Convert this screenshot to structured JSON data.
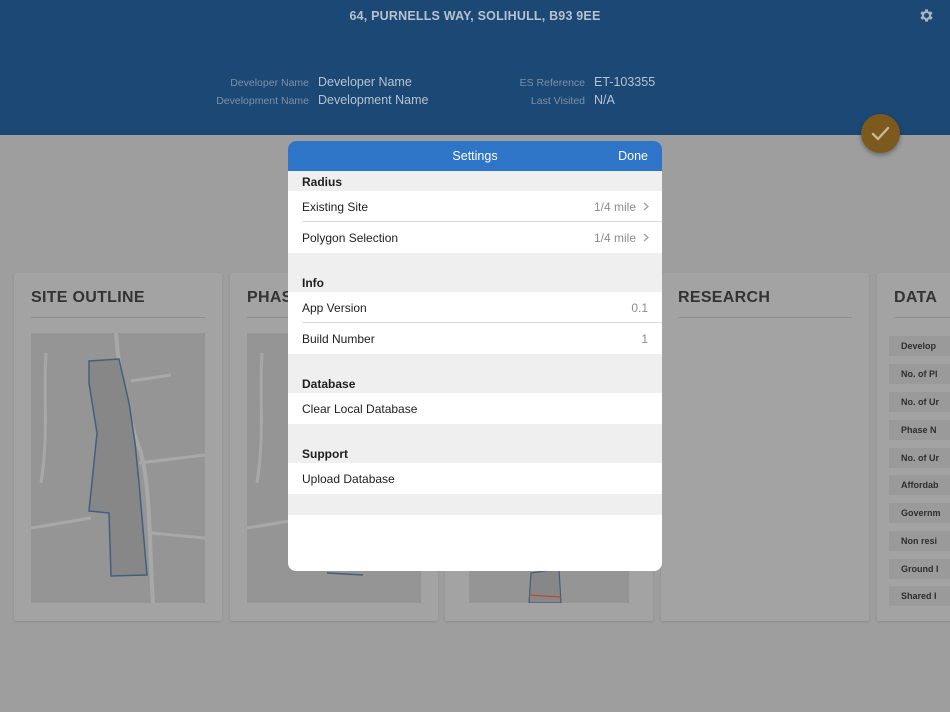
{
  "header": {
    "address": "64, PURNELLS WAY, SOLIHULL, B93 9EE",
    "developer_name_label": "Developer Name",
    "developer_name_value": "Developer Name",
    "development_name_label": "Development Name",
    "development_name_value": "Development Name",
    "es_reference_label": "ES Reference",
    "es_reference_value": "ET-103355",
    "last_visited_label": "Last Visited",
    "last_visited_value": "N/A",
    "settings_icon": "gear-icon",
    "confirm_icon": "checkmark-icon"
  },
  "cards": {
    "site_outline_title": "SITE OUTLINE",
    "phase_title": "PHAS",
    "research_title": "RESEARCH",
    "data_title": "DATA",
    "data_rows": [
      "Develop",
      "No. of Pl",
      "No. of Ur",
      "Phase N",
      "No. of Ur",
      "Affordab",
      "Governm",
      "Non resi",
      "Ground I",
      "Shared I"
    ]
  },
  "modal": {
    "title": "Settings",
    "done_label": "Done",
    "sections": {
      "radius": "Radius",
      "info": "Info",
      "database": "Database",
      "support": "Support"
    },
    "rows": {
      "existing_site_label": "Existing Site",
      "existing_site_value": "1/4 mile",
      "polygon_selection_label": "Polygon Selection",
      "polygon_selection_value": "1/4 mile",
      "app_version_label": "App Version",
      "app_version_value": "0.1",
      "build_number_label": "Build Number",
      "build_number_value": "1",
      "clear_local_db_label": "Clear Local Database",
      "upload_db_label": "Upload Database"
    }
  },
  "colors": {
    "header_bg": "#1c4875",
    "modal_header_bg": "#2e74c7",
    "fab_bg": "#7c5a1e"
  }
}
